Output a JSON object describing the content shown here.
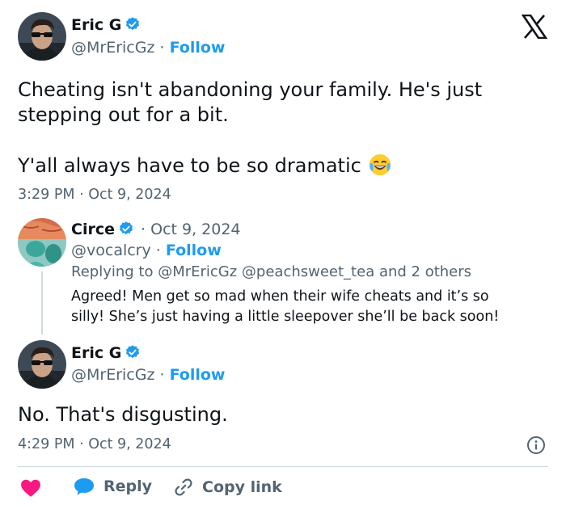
{
  "main_tweet": {
    "author_name": "Eric G",
    "handle": "@MrEricGz",
    "separator": "·",
    "follow_label": "Follow",
    "text_line1": "Cheating isn't abandoning your family. He's just",
    "text_line2": "stepping out for a bit.",
    "text_line3": "Y'all always have to be so dramatic",
    "emoji": "😂",
    "timestamp": "3:29 PM · Oct 9, 2024"
  },
  "reply_tweet": {
    "author_name": "Circe",
    "date": "· Oct 9, 2024",
    "handle": "@vocalcry",
    "separator": "·",
    "follow_label": "Follow",
    "replying_to": "Replying to @MrEricGz @peachsweet_tea and 2 others",
    "text_line1": "Agreed! Men get so mad when their wife cheats and it’s so",
    "text_line2": "silly! She’s just having a little sleepover she’ll be back soon!"
  },
  "response_tweet": {
    "author_name": "Eric G",
    "handle": "@MrEricGz",
    "separator": "·",
    "follow_label": "Follow",
    "text": "No. That's disgusting.",
    "timestamp": "4:29 PM · Oct 9, 2024"
  },
  "actions": {
    "reply_label": "Reply",
    "copy_link_label": "Copy link"
  },
  "icons": {
    "x_logo": "x-logo-icon",
    "verified": "verified-badge-icon",
    "info": "info-icon",
    "like": "heart-icon",
    "reply": "reply-bubble-icon",
    "link": "link-icon"
  },
  "colors": {
    "accent": "#1d9bf0",
    "like": "#f91880",
    "text": "#0f1419",
    "muted": "#536471",
    "divider": "#cfd9de"
  }
}
